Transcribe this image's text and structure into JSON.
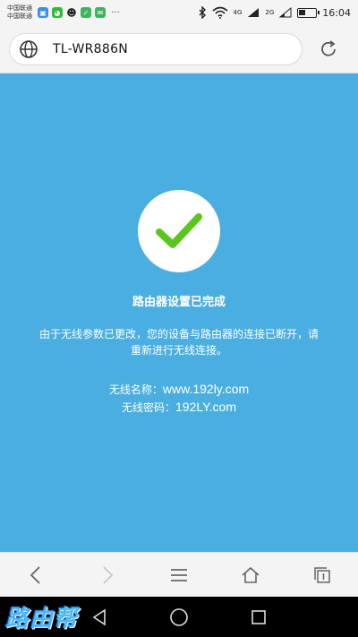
{
  "status_bar": {
    "carrier_1": "中国联通",
    "carrier_2": "中国联通",
    "net_1": "4G",
    "net_2": "2G",
    "time": "16:04"
  },
  "address_bar": {
    "url": "TL-WR886N"
  },
  "content": {
    "title": "路由器设置已完成",
    "message": "由于无线参数已更改，您的设备与路由器的连接已断开，请重新进行无线连接。",
    "wifi_name_label": "无线名称：",
    "wifi_name_value": "www.192ly.com",
    "wifi_password_label": "无线密码：",
    "wifi_password_value": "192LY.com"
  },
  "watermark": {
    "logo_text": "路由帮"
  },
  "colors": {
    "background": "#4aafe0",
    "check_green": "#5cc51d"
  }
}
